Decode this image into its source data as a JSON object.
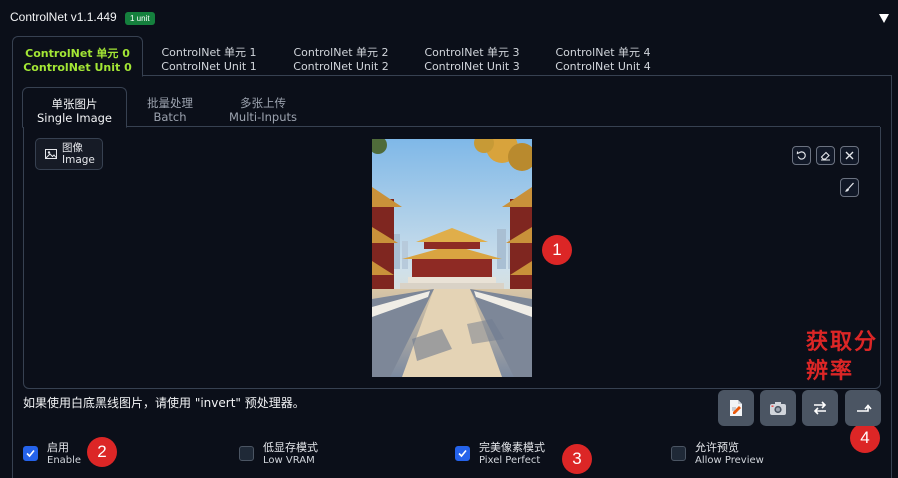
{
  "header": {
    "title": "ControlNet v1.1.449",
    "badge": "1 unit",
    "collapse_icon": "triangle-down-icon"
  },
  "unit_tabs": [
    {
      "zh": "ControlNet 单元 0",
      "en": "ControlNet Unit 0",
      "active": true
    },
    {
      "zh": "ControlNet 单元 1",
      "en": "ControlNet Unit 1",
      "active": false
    },
    {
      "zh": "ControlNet 单元 2",
      "en": "ControlNet Unit 2",
      "active": false
    },
    {
      "zh": "ControlNet 单元 3",
      "en": "ControlNet Unit 3",
      "active": false
    },
    {
      "zh": "ControlNet 单元 4",
      "en": "ControlNet Unit 4",
      "active": false
    }
  ],
  "input_tabs": [
    {
      "zh": "单张图片",
      "en": "Single Image",
      "active": true
    },
    {
      "zh": "批量处理",
      "en": "Batch",
      "active": false
    },
    {
      "zh": "多张上传",
      "en": "Multi-Inputs",
      "active": false
    }
  ],
  "image_panel": {
    "label_zh": "图像",
    "label_en": "Image",
    "tools": [
      "undo-icon",
      "eraser-icon",
      "close-icon",
      "brush-icon"
    ]
  },
  "markers": [
    "1",
    "2",
    "3",
    "4"
  ],
  "annotation": "获取分辨率",
  "hint": "如果使用白底黑线图片，请使用 \"invert\" 预处理器。",
  "action_buttons": [
    "edit-document-icon",
    "camera-icon",
    "swap-icon",
    "send-size-icon"
  ],
  "options": [
    {
      "zh": "启用",
      "en": "Enable",
      "checked": true
    },
    {
      "zh": "低显存模式",
      "en": "Low VRAM",
      "checked": false
    },
    {
      "zh": "完美像素模式",
      "en": "Pixel Perfect",
      "checked": true
    },
    {
      "zh": "允许预览",
      "en": "Allow Preview",
      "checked": false
    }
  ],
  "colors": {
    "background": "#0b0f19",
    "active_tab": "#a3e635",
    "badge": "#15803d",
    "checkbox_checked": "#2563eb",
    "marker": "#dc2626"
  }
}
